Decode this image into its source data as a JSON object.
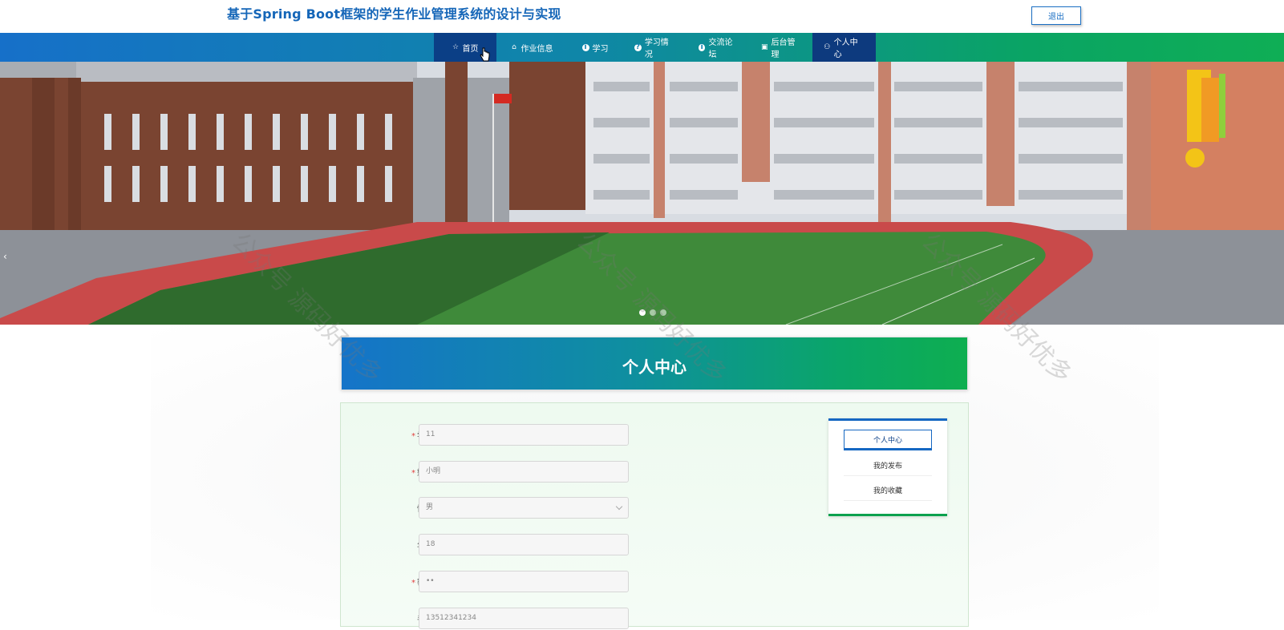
{
  "header": {
    "site_title": "基于Spring Boot框架的学生作业管理系统的设计与实现",
    "logout_label": "退出"
  },
  "nav": {
    "items": [
      {
        "label": "首页",
        "icon": "star-icon"
      },
      {
        "label": "作业信息",
        "icon": "bag-icon"
      },
      {
        "label": "学习",
        "icon": "info-dot-icon"
      },
      {
        "label": "学习情况",
        "icon": "question-dot-icon"
      },
      {
        "label": "交流论坛",
        "icon": "info-dot-icon"
      },
      {
        "label": "后台管理",
        "icon": "briefcase-icon"
      },
      {
        "label": "个人中心",
        "icon": "user-icon"
      }
    ]
  },
  "carousel": {
    "prev_arrow": "‹",
    "dot_count": 3,
    "active_dot": 0
  },
  "page": {
    "title": "个人中心"
  },
  "form": {
    "fields": [
      {
        "label": "学号",
        "required": true,
        "value": "11"
      },
      {
        "label": "姓名",
        "required": true,
        "value": "小明"
      },
      {
        "label": "性别",
        "required": false,
        "value": "男"
      },
      {
        "label": "年龄",
        "required": false,
        "value": "18"
      },
      {
        "label": "密码",
        "required": true,
        "value": "••"
      },
      {
        "label": "手机",
        "required": false,
        "value": "13512341234"
      }
    ]
  },
  "side_menu": {
    "items": [
      "个人中心",
      "我的发布",
      "我的收藏"
    ]
  },
  "watermark": {
    "text": "公众号 源码好优多"
  },
  "colors": {
    "primary_blue": "#1566b8",
    "nav_active": "#0b3f86",
    "accent_green": "#0ca14e",
    "required_red": "#e04040"
  }
}
